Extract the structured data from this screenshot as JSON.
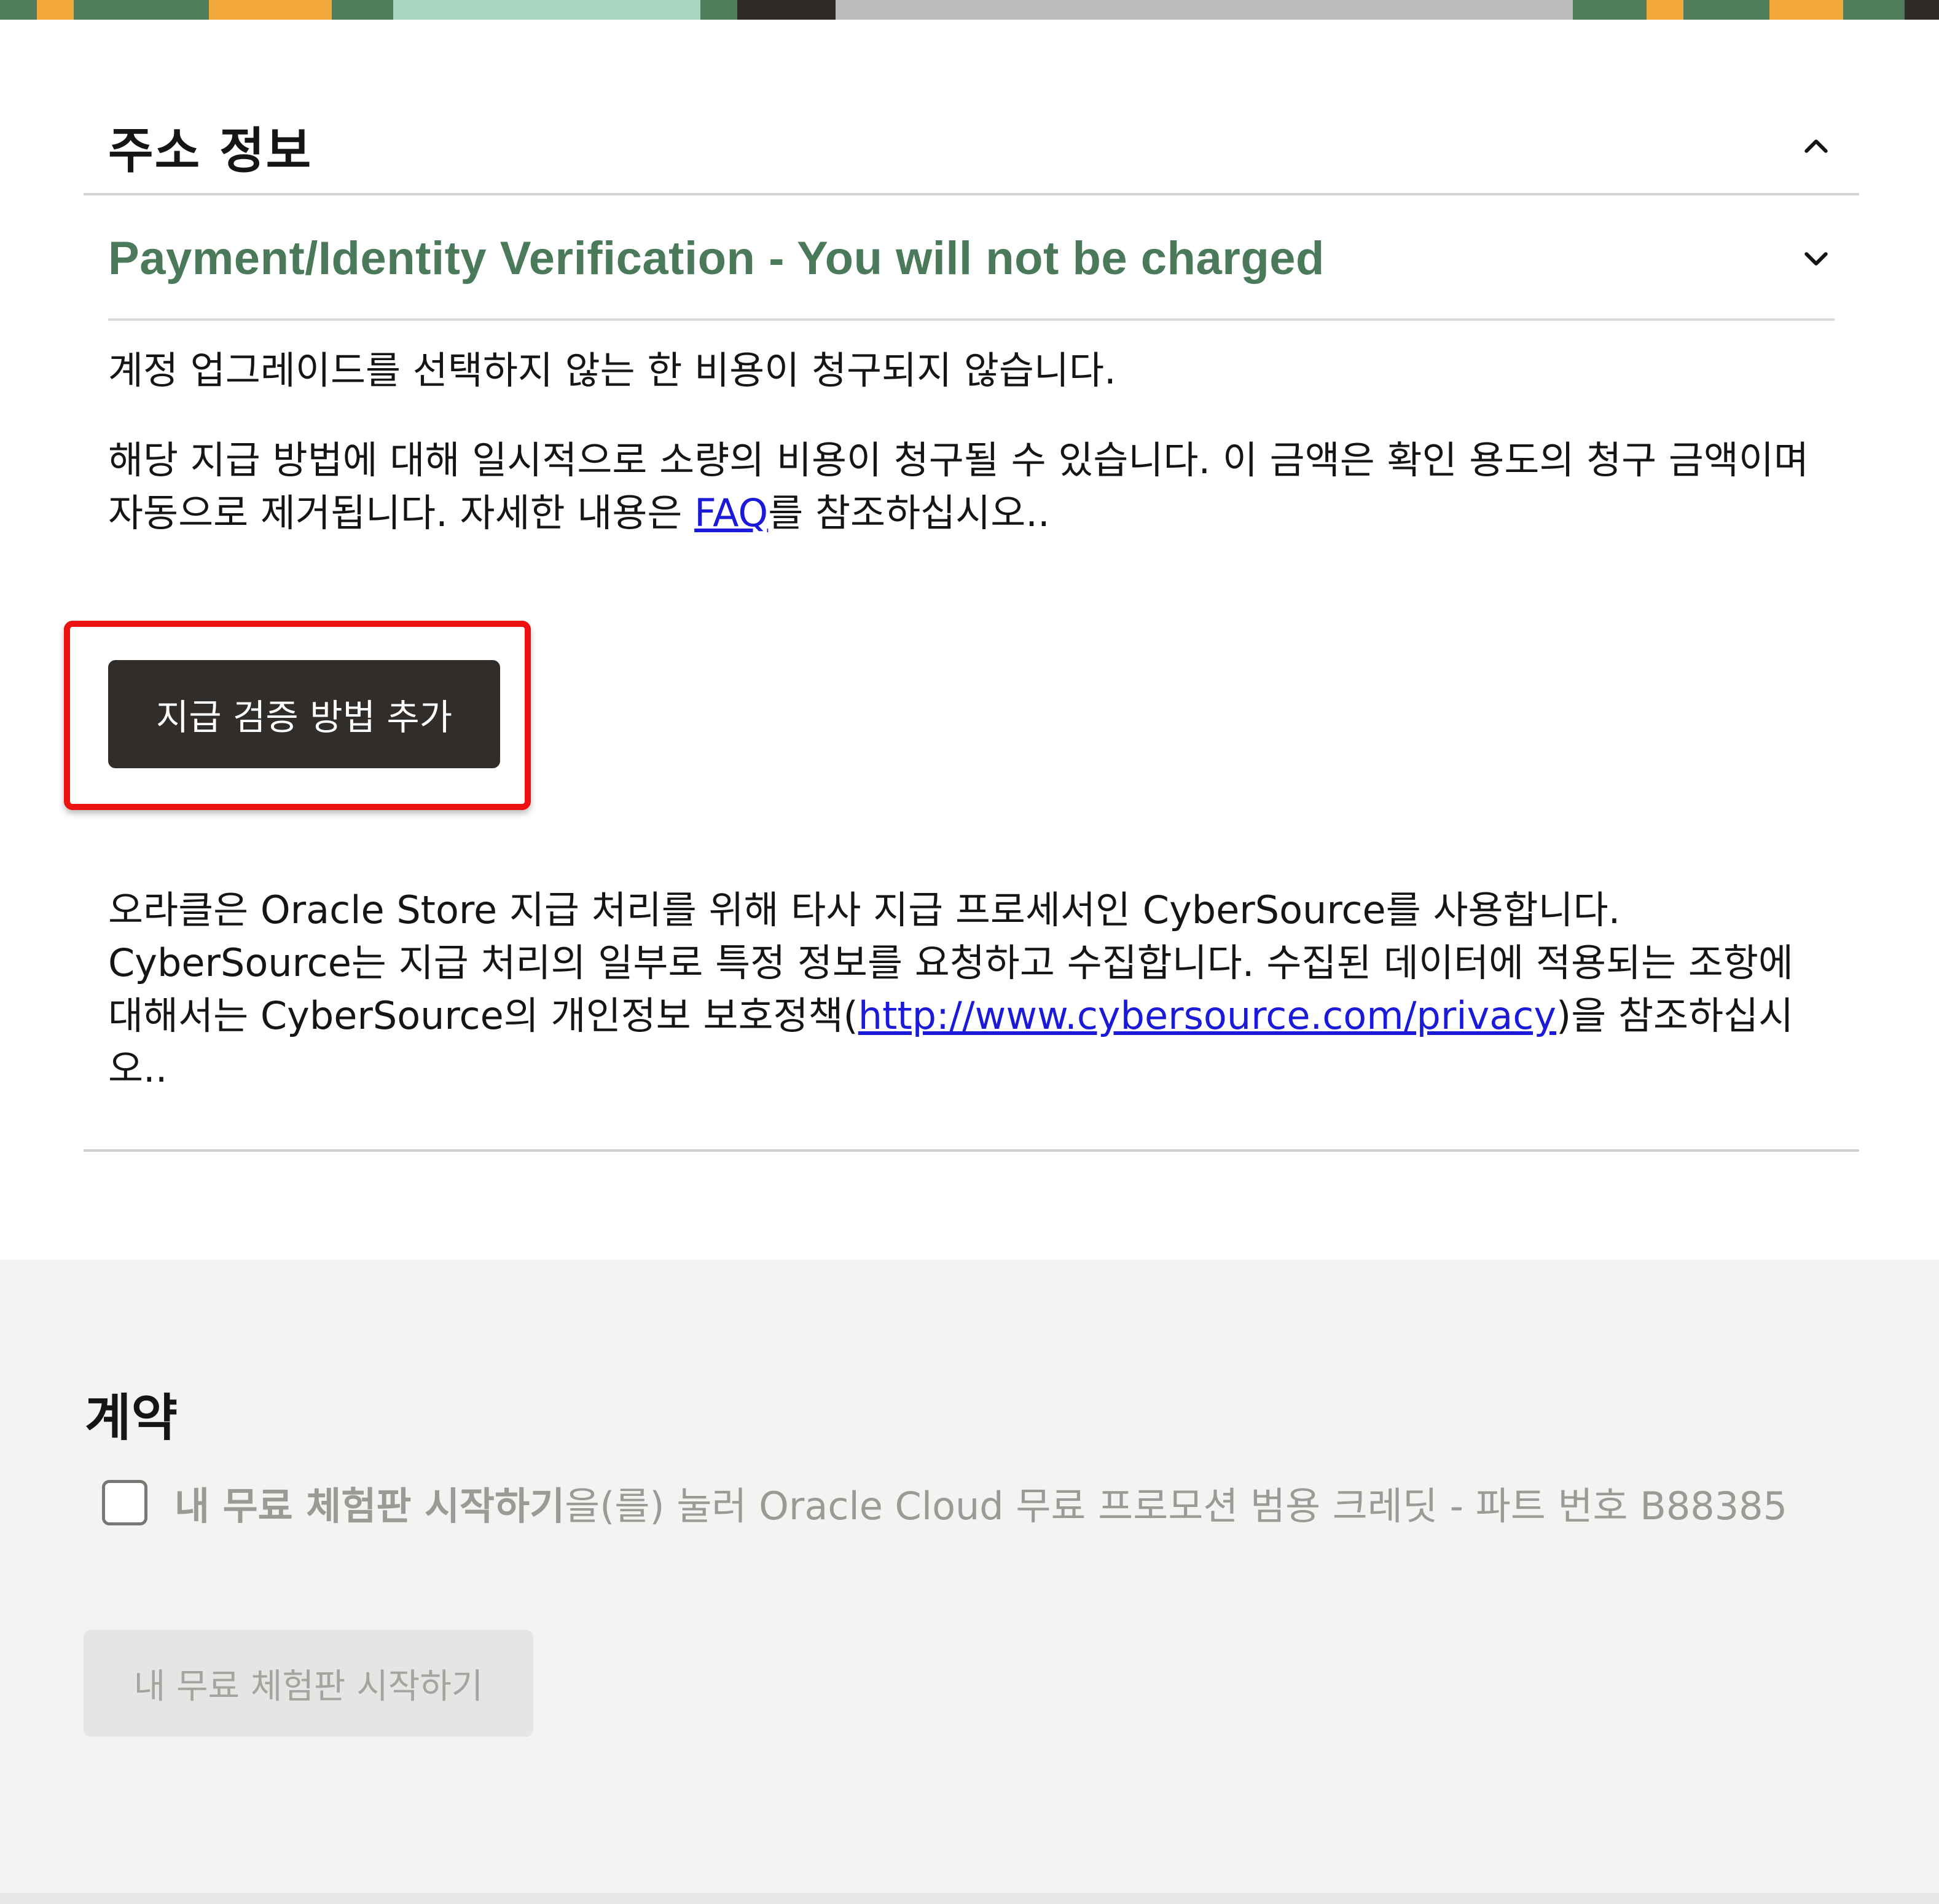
{
  "address_section": {
    "title": "주소 정보"
  },
  "payment_section": {
    "title": "Payment/Identity Verification - You will not be charged",
    "notice": "계정 업그레이드를 선택하지 않는 한 비용이 청구되지 않습니다.",
    "temp_charge_text": "해당 지급 방법에 대해 일시적으로 소량의 비용이 청구될 수 있습니다. 이 금액은 확인 용도의 청구 금액이며 자동으로 제거됩니다. 자세한 내용은 ",
    "faq_link": "FAQ",
    "temp_charge_suffix": "를 참조하십시오..",
    "add_button_label": "지급 검증 방법 추가",
    "processor_text": "오라클은 Oracle Store 지급 처리를 위해 타사 지급 프로세서인 CyberSource를 사용합니다. CyberSource는 지급 처리의 일부로 특정 정보를 요청하고 수집합니다. 수집된 데이터에 적용되는 조항에 대해서는 CyberSource의 개인정보 보호정책(",
    "privacy_link": "http://www.cybersource.com/privacy",
    "processor_suffix": ")을 참조하십시오.."
  },
  "contract_section": {
    "title": "계약",
    "checkbox_bold": "내 무료 체험판 시작하기",
    "checkbox_text": "을(를) 눌러 Oracle Cloud 무료 프로모션 범용 크레딧 - 파트 번호 B88385",
    "start_button_label": "내 무료 체험판 시작하기"
  },
  "colors": {
    "payment_title": "#4a7a5a",
    "primary_button": "#312d2a",
    "highlight": "#ee1111",
    "link": "#1a1ad8"
  },
  "icons": {
    "address_toggle": "chevron-up-icon",
    "payment_toggle": "chevron-down-icon"
  }
}
